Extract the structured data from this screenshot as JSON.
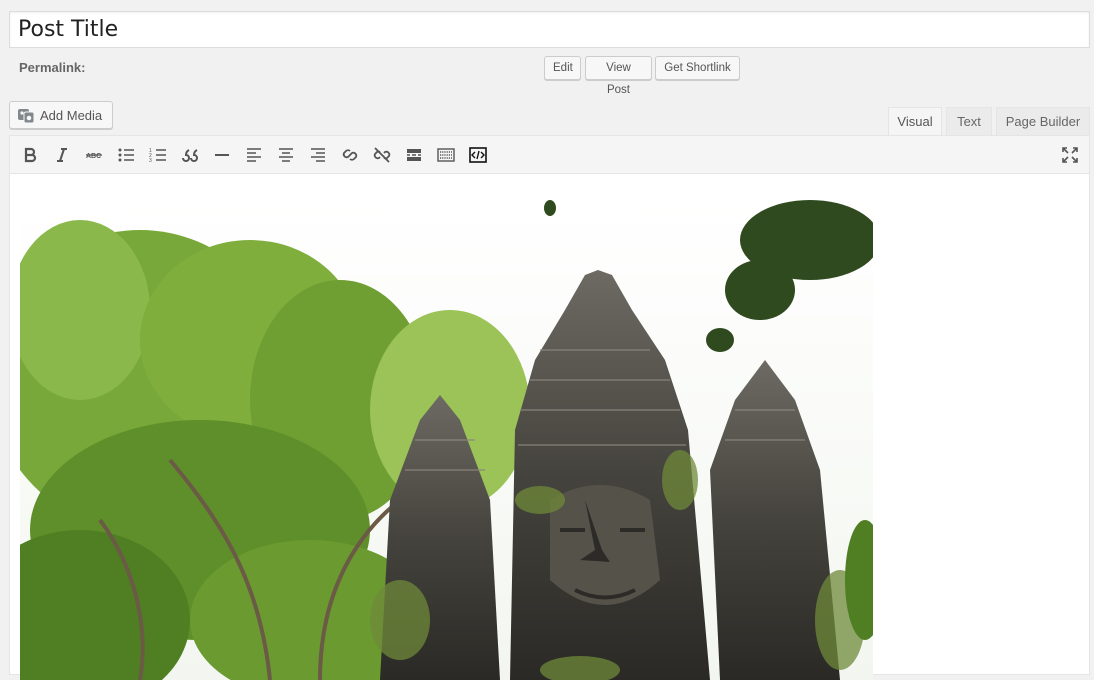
{
  "post": {
    "title": "Post Title"
  },
  "permalink": {
    "label": "Permalink:",
    "buttons": {
      "edit": "Edit",
      "view_post": "View Post",
      "get_shortlink": "Get Shortlink"
    }
  },
  "media": {
    "add_media_label": "Add Media"
  },
  "editor_tabs": {
    "visual": "Visual",
    "text": "Text",
    "page_builder": "Page Builder",
    "active": "Visual"
  },
  "toolbar": {
    "icons": [
      "bold-icon",
      "italic-icon",
      "strikethrough-icon",
      "bullet-list-icon",
      "numbered-list-icon",
      "blockquote-icon",
      "horizontal-rule-icon",
      "align-left-icon",
      "align-center-icon",
      "align-right-icon",
      "link-icon",
      "unlink-icon",
      "read-more-icon",
      "toolbar-toggle-icon",
      "embed-icon",
      "fullscreen-icon"
    ]
  },
  "content": {
    "image": "temple-photo"
  },
  "colors": {
    "background": "#f1f1f1",
    "panel": "#f5f5f5",
    "border": "#e5e5e5",
    "text": "#444444"
  }
}
